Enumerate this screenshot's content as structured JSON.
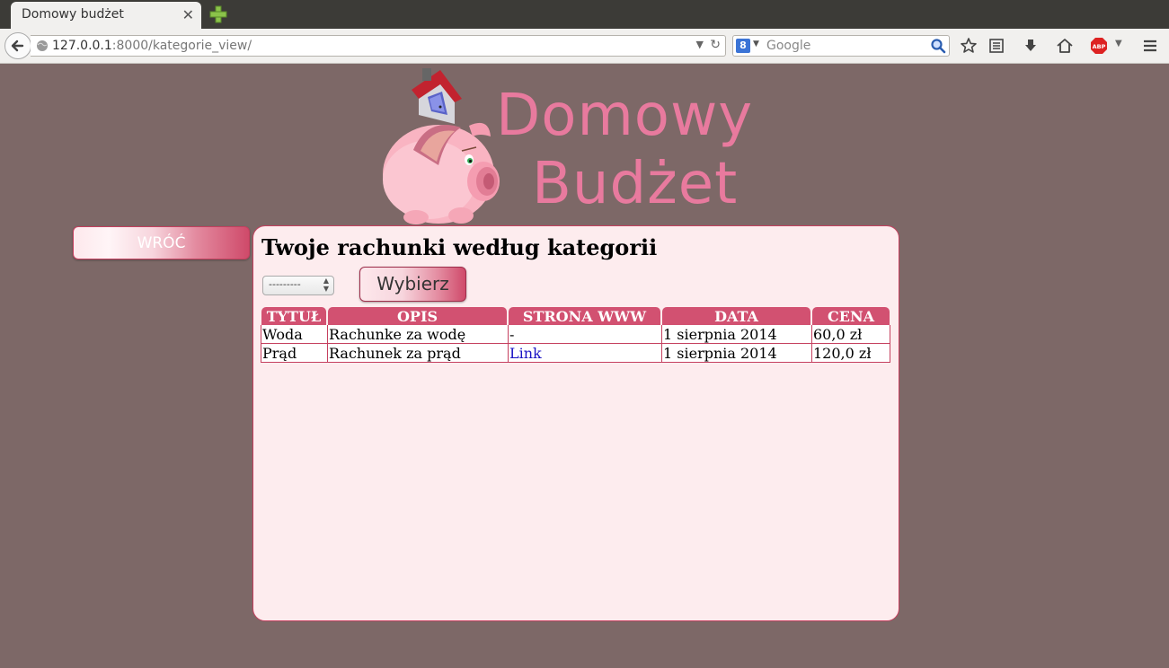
{
  "browser": {
    "tab_title": "Domowy budżet",
    "tab_close": "✕",
    "url_host": "127.0.0.1",
    "url_rest": ":8000/kategorie_view/",
    "search_placeholder": "Google",
    "search_engine_letter": "8"
  },
  "logo": {
    "line1": "Domowy",
    "line2": "Budżet"
  },
  "nav": {
    "back_label": "WRÓĆ"
  },
  "main": {
    "title": "Twoje rachunki według kategorii",
    "select_value": "---------",
    "choose_button": "Wybierz",
    "table": {
      "headers": [
        "TYTUŁ",
        "OPIS",
        "STRONA WWW",
        "DATA",
        "CENA"
      ],
      "rows": [
        {
          "title": "Woda",
          "description": "Rachunke za wodę",
          "website": "-",
          "date": "1 sierpnia 2014",
          "price": "60,0 zł"
        },
        {
          "title": "Prąd",
          "description": "Rachunek za prąd",
          "website": "Link",
          "date": "1 sierpnia 2014",
          "price": "120,0 zł"
        }
      ]
    }
  },
  "colors": {
    "page_background": "#7d6867",
    "panel_background": "#fdecee",
    "accent": "#d25171",
    "link": "#1a13c4"
  }
}
